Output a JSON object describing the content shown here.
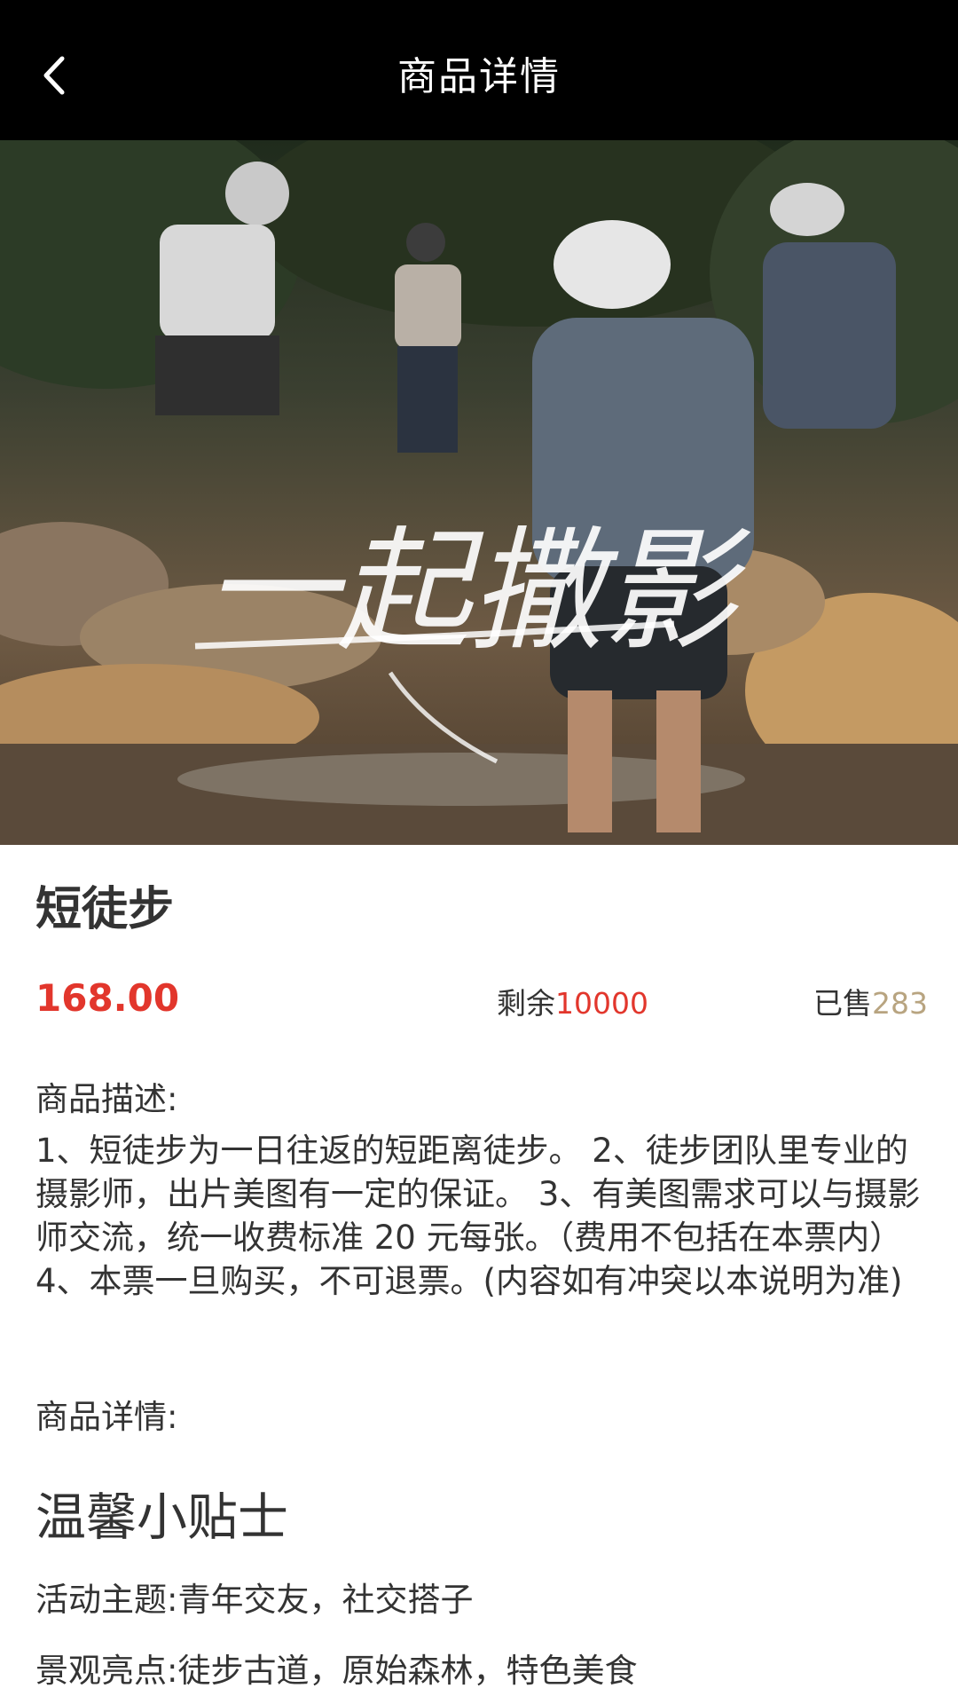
{
  "header": {
    "title": "商品详情",
    "back_icon": "chevron-left-icon"
  },
  "hero": {
    "watermark_text": "一起撒影"
  },
  "product": {
    "name": "短徒步",
    "price": "168.00",
    "stock_label": "剩余",
    "stock_value": "10000",
    "sold_label": "已售",
    "sold_value": "283"
  },
  "description": {
    "label": "商品描述:",
    "text": "1、短徒步为一日往返的短距离徒步。 2、徒步团队里专业的摄影师，出片美图有一定的保证。 3、有美图需求可以与摄影师交流，统一收费标准 20 元每张。（费用不包括在本票内） 4、本票一旦购买，不可退票。(内容如有冲突以本说明为准)"
  },
  "details": {
    "label": "商品详情:",
    "tips_title": "温馨小贴士",
    "lines": [
      "活动主题:青年交友，社交搭子",
      "景观亮点:徒步古道，原始森林，特色美食"
    ]
  },
  "colors": {
    "header_bg": "#000000",
    "price_red": "#e2362c",
    "sold_gold": "#b8a480"
  }
}
